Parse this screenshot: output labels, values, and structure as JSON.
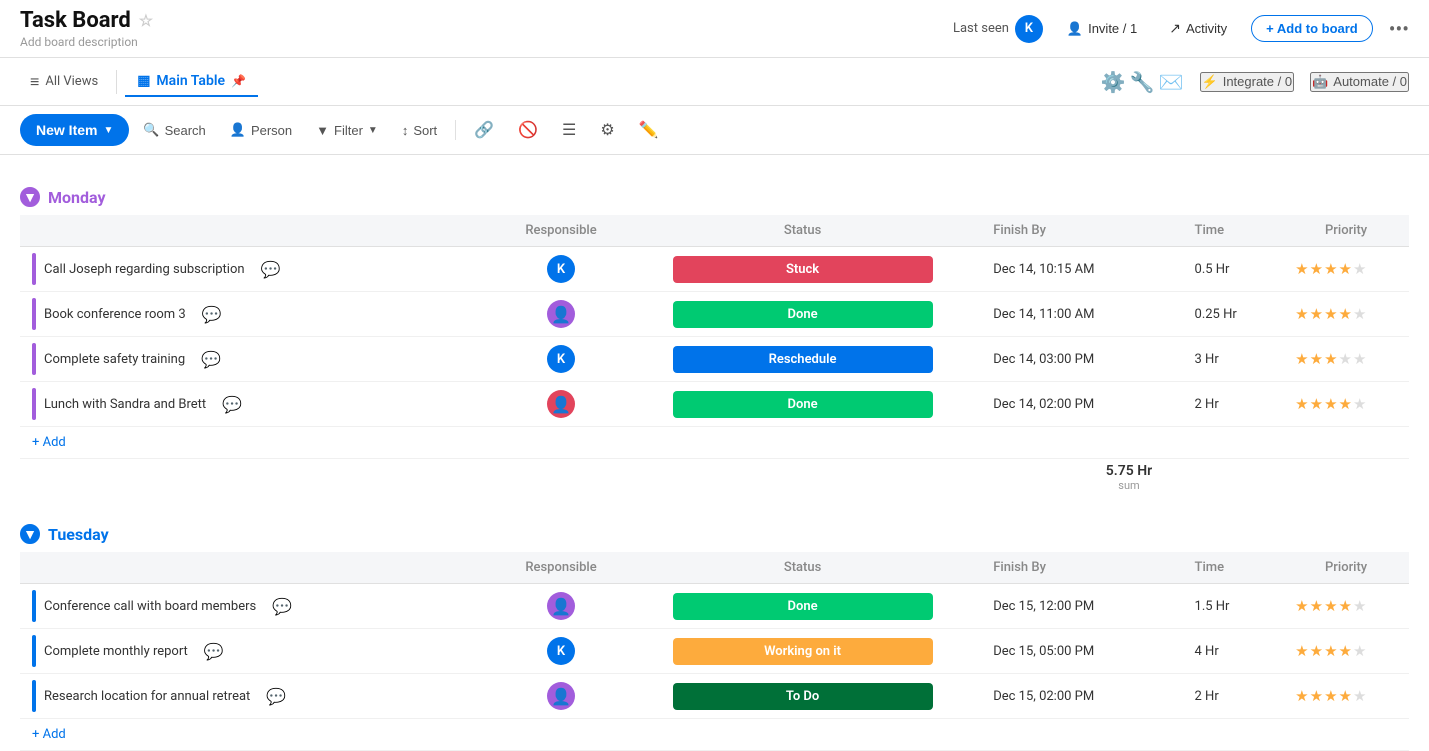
{
  "header": {
    "title": "Task Board",
    "subtitle": "Add board description",
    "last_seen_label": "Last seen",
    "invite_label": "Invite / 1",
    "activity_label": "Activity",
    "add_to_board_label": "+ Add to board",
    "more_icon": "•••",
    "avatar_initial": "K"
  },
  "nav": {
    "all_views_label": "All Views",
    "main_table_label": "Main Table",
    "integrate_label": "Integrate / 0",
    "automate_label": "Automate / 0"
  },
  "toolbar": {
    "new_item_label": "New Item",
    "search_label": "Search",
    "person_label": "Person",
    "filter_label": "Filter",
    "sort_label": "Sort"
  },
  "groups": [
    {
      "id": "monday",
      "title": "Monday",
      "color_class": "monday",
      "columns": {
        "responsible": "Responsible",
        "status": "Status",
        "finish_by": "Finish By",
        "time": "Time",
        "priority": "Priority"
      },
      "tasks": [
        {
          "name": "Call Joseph regarding subscription",
          "avatar": "K",
          "avatar_type": "initial",
          "avatar_color": "#0073ea",
          "status": "Stuck",
          "status_class": "status-stuck",
          "finish_by": "Dec 14, 10:15 AM",
          "time": "0.5 Hr",
          "stars": 4,
          "max_stars": 5
        },
        {
          "name": "Book conference room 3",
          "avatar": "👤",
          "avatar_type": "image",
          "avatar_color": "#a25ddc",
          "status": "Done",
          "status_class": "status-done",
          "finish_by": "Dec 14, 11:00 AM",
          "time": "0.25 Hr",
          "stars": 4,
          "max_stars": 5
        },
        {
          "name": "Complete safety training",
          "avatar": "K",
          "avatar_type": "initial",
          "avatar_color": "#0073ea",
          "status": "Reschedule",
          "status_class": "status-reschedule",
          "finish_by": "Dec 14, 03:00 PM",
          "time": "3 Hr",
          "stars": 3,
          "max_stars": 5
        },
        {
          "name": "Lunch with Sandra and Brett",
          "avatar": "👤",
          "avatar_type": "image",
          "avatar_color": "#e2445c",
          "status": "Done",
          "status_class": "status-done",
          "finish_by": "Dec 14, 02:00 PM",
          "time": "2 Hr",
          "stars": 4,
          "max_stars": 5
        }
      ],
      "add_label": "+ Add",
      "sum_value": "5.75 Hr",
      "sum_label": "sum"
    },
    {
      "id": "tuesday",
      "title": "Tuesday",
      "color_class": "tuesday",
      "columns": {
        "responsible": "Responsible",
        "status": "Status",
        "finish_by": "Finish By",
        "time": "Time",
        "priority": "Priority"
      },
      "tasks": [
        {
          "name": "Conference call with board members",
          "avatar": "👤",
          "avatar_type": "image",
          "avatar_color": "#a25ddc",
          "status": "Done",
          "status_class": "status-done",
          "finish_by": "Dec 15, 12:00 PM",
          "time": "1.5 Hr",
          "stars": 4,
          "max_stars": 5
        },
        {
          "name": "Complete monthly report",
          "avatar": "K",
          "avatar_type": "initial",
          "avatar_color": "#0073ea",
          "status": "Working on it",
          "status_class": "status-working",
          "finish_by": "Dec 15, 05:00 PM",
          "time": "4 Hr",
          "stars": 4,
          "max_stars": 5
        },
        {
          "name": "Research location for annual retreat",
          "avatar": "👤",
          "avatar_type": "image",
          "avatar_color": "#a25ddc",
          "status": "To Do",
          "status_class": "status-todo",
          "finish_by": "Dec 15, 02:00 PM",
          "time": "2 Hr",
          "stars": 4,
          "max_stars": 5
        }
      ],
      "add_label": "+ Add",
      "sum_value": "",
      "sum_label": ""
    }
  ]
}
